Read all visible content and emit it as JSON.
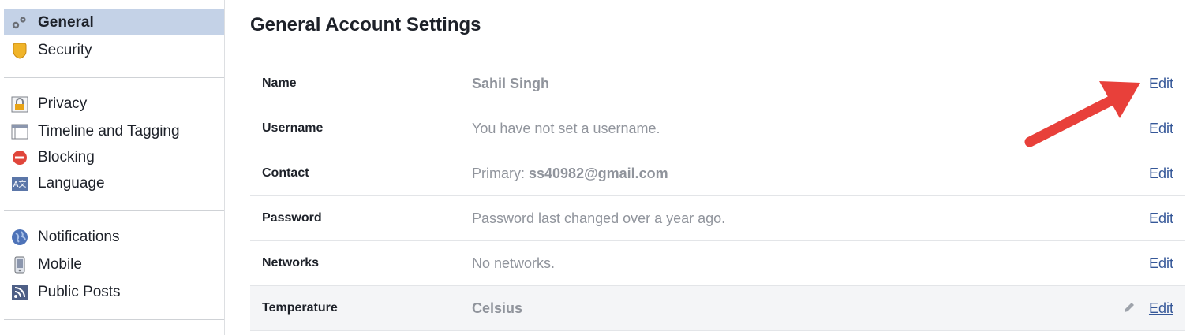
{
  "sidebar": {
    "groups": [
      {
        "items": [
          {
            "label": "General",
            "icon": "gears-icon",
            "active": true
          },
          {
            "label": "Security",
            "icon": "shield-icon",
            "active": false
          }
        ]
      },
      {
        "items": [
          {
            "label": "Privacy",
            "icon": "lock-icon"
          },
          {
            "label": "Timeline and Tagging",
            "icon": "timeline-icon"
          },
          {
            "label": "Blocking",
            "icon": "block-icon"
          },
          {
            "label": "Language",
            "icon": "language-icon"
          }
        ]
      },
      {
        "items": [
          {
            "label": "Notifications",
            "icon": "globe-icon"
          },
          {
            "label": "Mobile",
            "icon": "phone-icon"
          },
          {
            "label": "Public Posts",
            "icon": "rss-icon"
          }
        ]
      }
    ]
  },
  "main": {
    "title": "General Account Settings",
    "rows": [
      {
        "label": "Name",
        "value": "Sahil Singh",
        "edit": "Edit"
      },
      {
        "label": "Username",
        "value": "You have not set a username.",
        "edit": "Edit"
      },
      {
        "label": "Contact",
        "value_prefix": "Primary: ",
        "value": "ss40982@gmail.com",
        "edit": "Edit"
      },
      {
        "label": "Password",
        "value": "Password last changed over a year ago.",
        "edit": "Edit"
      },
      {
        "label": "Networks",
        "value": "No networks.",
        "edit": "Edit"
      },
      {
        "label": "Temperature",
        "value": "Celsius",
        "edit": "Edit"
      }
    ]
  },
  "colors": {
    "active_bg": "#c4d2e7",
    "link": "#365899",
    "muted_text": "#90949c",
    "arrow": "#e8403a"
  }
}
